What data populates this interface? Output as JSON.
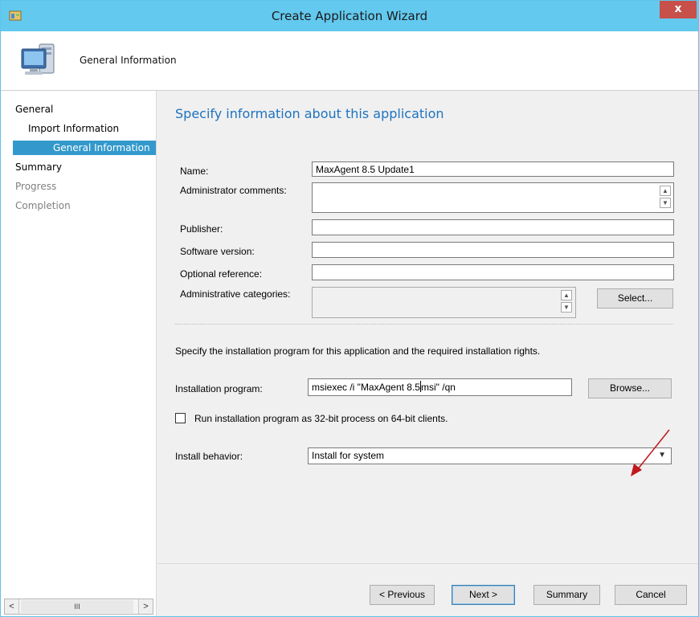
{
  "window": {
    "title": "Create Application Wizard",
    "close_label": "x"
  },
  "header": {
    "title": "General Information",
    "icon": "computer-icon"
  },
  "sidebar": {
    "items": [
      {
        "label": "General",
        "state": "normal"
      },
      {
        "label": "Import Information",
        "state": "normal"
      },
      {
        "label": "General Information",
        "state": "selected"
      },
      {
        "label": "Summary",
        "state": "normal"
      },
      {
        "label": "Progress",
        "state": "disabled"
      },
      {
        "label": "Completion",
        "state": "disabled"
      }
    ],
    "scrollbar": {
      "left": "<",
      "thumb": "III",
      "right": ">"
    }
  },
  "main": {
    "heading": "Specify information about this application",
    "fields": {
      "name": {
        "label": "Name:",
        "value": "MaxAgent 8.5 Update1"
      },
      "admin_comments": {
        "label": "Administrator comments:",
        "value": ""
      },
      "publisher": {
        "label": "Publisher:",
        "value": ""
      },
      "software_version": {
        "label": "Software version:",
        "value": ""
      },
      "optional_reference": {
        "label": "Optional reference:",
        "value": ""
      },
      "admin_categories": {
        "label": "Administrative categories:",
        "value": ""
      }
    },
    "select_button": "Select...",
    "install_section_text": "Specify the installation program for this application and the required installation rights.",
    "installation_program": {
      "label": "Installation program:",
      "value_before_cursor": "msiexec /i \"MaxAgent 8.5",
      "value_after_cursor": "msi\" /qn"
    },
    "browse_button": "Browse...",
    "run_32bit": {
      "label": "Run installation program as 32-bit process on 64-bit clients.",
      "checked": false
    },
    "install_behavior": {
      "label": "Install behavior:",
      "value": "Install for system"
    },
    "annotation_color": "#c0181e"
  },
  "footer": {
    "previous": "< Previous",
    "next": "Next >",
    "summary": "Summary",
    "cancel": "Cancel"
  }
}
